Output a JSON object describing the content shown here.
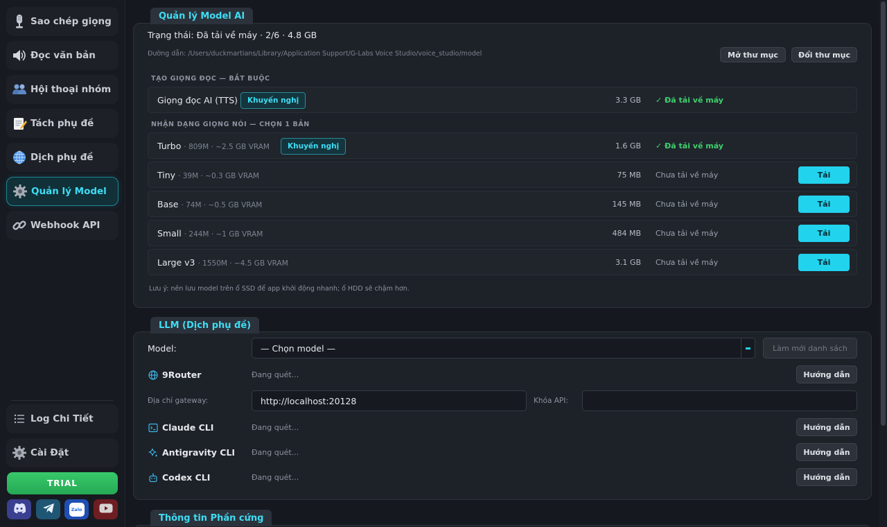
{
  "sidebar": {
    "items": [
      {
        "label": "Sao chép giọng",
        "icon": "microphone-icon"
      },
      {
        "label": "Đọc văn bản",
        "icon": "speaker-icon"
      },
      {
        "label": "Hội thoại nhóm",
        "icon": "people-icon"
      },
      {
        "label": "Tách phụ đề",
        "icon": "memo-icon"
      },
      {
        "label": "Dịch phụ đề",
        "icon": "globe-icon"
      },
      {
        "label": "Quản lý Model",
        "icon": "gear-icon",
        "active": true
      },
      {
        "label": "Webhook API",
        "icon": "link-icon"
      }
    ],
    "bottom_items": [
      {
        "label": "Log Chi Tiết",
        "icon": "list-icon"
      },
      {
        "label": "Cài Đặt",
        "icon": "gear-icon"
      }
    ],
    "trial_label": "TRIAL",
    "social": [
      "discord-icon",
      "telegram-icon",
      "zalo-icon",
      "youtube-icon"
    ],
    "zalo_text": "Zalo"
  },
  "model_section": {
    "tab": "Quản lý Model AI",
    "status": "Trạng thái: Đã tải về máy  ·  2/6  ·  4.8 GB",
    "path": "Đường dẫn: /Users/duckmartians/Library/Application Support/G-Labs Voice Studio/voice_studio/model",
    "open_folder": "Mở thư mục",
    "change_folder": "Đổi thư mục",
    "group_tts": "TẠO GIỌNG ĐỌC — BẮT BUỘC",
    "group_asr": "NHẬN DẠNG GIỌNG NÓI — CHỌN 1 BẢN",
    "recommend": "Khuyến nghị",
    "download_label": "Tải",
    "rows": [
      {
        "name": "Giọng đọc AI (TTS)",
        "meta": "",
        "size": "3.3 GB",
        "status": "✓ Đã tải về máy",
        "downloaded": true,
        "recommended": true
      },
      {
        "name": "Turbo",
        "meta": "· 809M · ~2.5 GB VRAM",
        "size": "1.6 GB",
        "status": "✓ Đã tải về máy",
        "downloaded": true,
        "recommended": true
      },
      {
        "name": "Tiny",
        "meta": "· 39M · ~0.3 GB VRAM",
        "size": "75 MB",
        "status": "Chưa tải về máy",
        "downloaded": false
      },
      {
        "name": "Base",
        "meta": "· 74M · ~0.5 GB VRAM",
        "size": "145 MB",
        "status": "Chưa tải về máy",
        "downloaded": false
      },
      {
        "name": "Small",
        "meta": "· 244M · ~1 GB VRAM",
        "size": "484 MB",
        "status": "Chưa tải về máy",
        "downloaded": false
      },
      {
        "name": "Large v3",
        "meta": "· 1550M · ~4.5 GB VRAM",
        "size": "3.1 GB",
        "status": "Chưa tải về máy",
        "downloaded": false
      }
    ],
    "note": "Lưu ý: nên lưu model trên ổ SSD để app khởi động nhanh; ổ HDD sẽ chậm hơn."
  },
  "llm_section": {
    "tab": "LLM (Dịch phụ đề)",
    "model_label": "Model:",
    "model_value": "— Chọn model —",
    "refresh_label": "Làm mới danh sách",
    "guide_label": "Hướng dẫn",
    "scanning": "Đang quét...",
    "router_label": "9Router",
    "gateway_label": "Địa chỉ gateway:",
    "gateway_value": "http://localhost:20128",
    "api_key_label": "Khóa API:",
    "api_key_value": "",
    "claude_label": "Claude CLI",
    "antigravity_label": "Antigravity CLI",
    "codex_label": "Codex CLI"
  },
  "hardware_section": {
    "tab": "Thông tin Phần cứng"
  },
  "colors": {
    "accent": "#22d3ee",
    "success": "#3ecf6b",
    "trial": "#2fbf62"
  }
}
